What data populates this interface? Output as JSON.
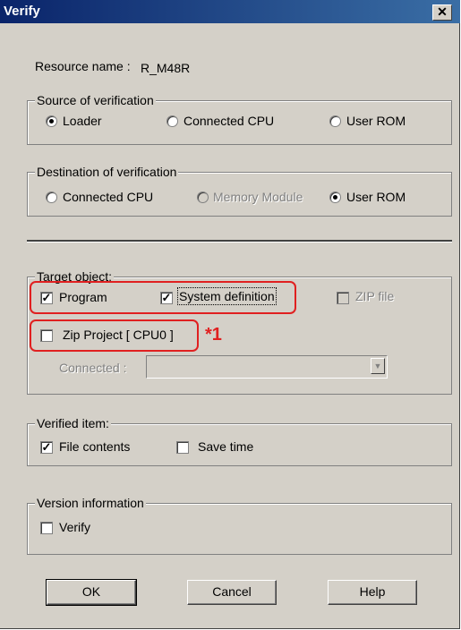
{
  "window": {
    "title": "Verify",
    "close_label": "✕"
  },
  "resource": {
    "label": "Resource name :",
    "value": "R_M48R"
  },
  "source_group": {
    "legend": "Source of verification",
    "options": [
      {
        "label": "Loader",
        "selected": true,
        "enabled": true
      },
      {
        "label": "Connected CPU",
        "selected": false,
        "enabled": true
      },
      {
        "label": "User ROM",
        "selected": false,
        "enabled": true
      }
    ]
  },
  "destination_group": {
    "legend": "Destination of verification",
    "options": [
      {
        "label": "Connected CPU",
        "selected": false,
        "enabled": true
      },
      {
        "label": "Memory Module",
        "selected": false,
        "enabled": false
      },
      {
        "label": "User ROM",
        "selected": true,
        "enabled": true
      }
    ]
  },
  "target_group": {
    "legend": "Target object:",
    "program": {
      "label": "Program",
      "checked": true
    },
    "system_definition": {
      "label": "System definition",
      "checked": true
    },
    "zip_file": {
      "label": "ZIP file",
      "checked": false,
      "enabled": false
    },
    "zip_project": {
      "label": "Zip Project [ CPU0 ]",
      "checked": false
    },
    "annotation": "*1",
    "connected": {
      "label": "Connected :",
      "value": ""
    }
  },
  "verified_group": {
    "legend": "Verified item:",
    "file_contents": {
      "label": "File contents",
      "checked": true
    },
    "save_time": {
      "label": "Save time",
      "checked": false
    }
  },
  "version_group": {
    "legend": "Version information",
    "verify": {
      "label": "Verify",
      "checked": false
    }
  },
  "buttons": {
    "ok": "OK",
    "cancel": "Cancel",
    "help": "Help"
  },
  "colors": {
    "title_bar": "#0a246a",
    "highlight": "#e02020",
    "dialog_bg": "#d4d0c8"
  }
}
